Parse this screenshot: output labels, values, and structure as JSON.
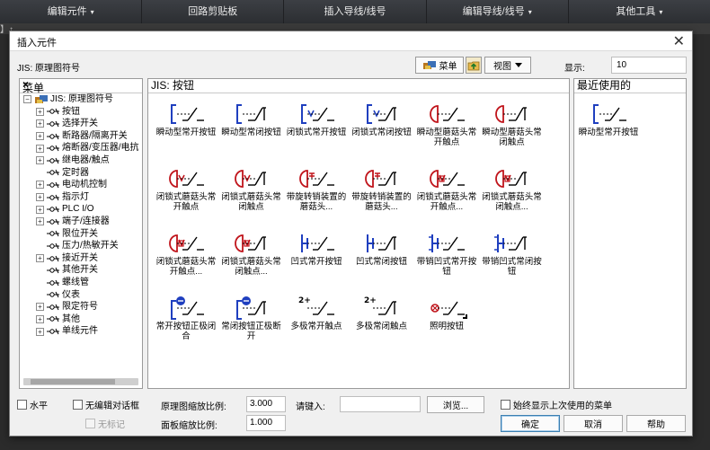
{
  "topbar": {
    "items": [
      "编辑元件",
      "回路剪贴板",
      "插入导线/线号",
      "编辑导线/线号",
      "其他工具"
    ],
    "carets": [
      "▾",
      "",
      "",
      "▾",
      "▾"
    ]
  },
  "strip": {
    "label": "】↑"
  },
  "dialog": {
    "title": "插入元件",
    "close": "✕",
    "path": "JIS: 原理图符号",
    "menu_button": "菜单",
    "view_button": "视图",
    "display_label": "显示:",
    "display_value": "10"
  },
  "tree": {
    "header": "菜单",
    "root": "JIS: 原理图符号",
    "items": [
      {
        "label": "按钮",
        "exp": true
      },
      {
        "label": "选择开关",
        "exp": true
      },
      {
        "label": "断路器/隔离开关",
        "exp": true
      },
      {
        "label": "熔断器/变压器/电抗",
        "exp": true
      },
      {
        "label": "继电器/触点",
        "exp": true
      },
      {
        "label": "定时器",
        "exp": false
      },
      {
        "label": "电动机控制",
        "exp": true
      },
      {
        "label": "指示灯",
        "exp": true
      },
      {
        "label": "PLC I/O",
        "exp": true
      },
      {
        "label": "端子/连接器",
        "exp": true
      },
      {
        "label": "限位开关",
        "exp": false
      },
      {
        "label": "压力/热敏开关",
        "exp": false
      },
      {
        "label": "接近开关",
        "exp": true
      },
      {
        "label": "其他开关",
        "exp": false
      },
      {
        "label": "螺线管",
        "exp": false
      },
      {
        "label": "仪表",
        "exp": false
      },
      {
        "label": "限定符号",
        "exp": true
      },
      {
        "label": "其他",
        "exp": true
      },
      {
        "label": "单线元件",
        "exp": true
      }
    ]
  },
  "grid": {
    "header": "JIS: 按钮",
    "items": [
      {
        "label": "瞬动型常开按钮",
        "icon": "pb-no",
        "color": "#1f3fbf"
      },
      {
        "label": "瞬动型常闭按钮",
        "icon": "pb-nc",
        "color": "#1f3fbf"
      },
      {
        "label": "闭锁式常开按钮",
        "icon": "pb-latch-no",
        "color": "#1f3fbf"
      },
      {
        "label": "闭锁式常闭按钮",
        "icon": "pb-latch-nc",
        "color": "#1f3fbf"
      },
      {
        "label": "瞬动型蘑菇头常开触点",
        "icon": "mush-no",
        "color": "#c0141b"
      },
      {
        "label": "瞬动型蘑菇头常闭触点",
        "icon": "mush-nc",
        "color": "#c0141b"
      },
      {
        "label": "闭锁式蘑菇头常开触点",
        "icon": "mush-latch-no",
        "color": "#c0141b"
      },
      {
        "label": "闭锁式蘑菇头常闭触点",
        "icon": "mush-latch-nc",
        "color": "#c0141b"
      },
      {
        "label": "带旋转销装置的蘑菇头...",
        "icon": "mush-twist-no",
        "color": "#c0141b"
      },
      {
        "label": "带旋转销装置的蘑菇头...",
        "icon": "mush-twist-nc",
        "color": "#c0141b"
      },
      {
        "label": "闭锁式蘑菇头常开触点...",
        "icon": "mush-latch-no2",
        "color": "#c0141b"
      },
      {
        "label": "闭锁式蘑菇头常闭触点...",
        "icon": "mush-latch-nc2",
        "color": "#c0141b"
      },
      {
        "label": "闭锁式蘑菇头常开触点...",
        "icon": "mush-latch-no3",
        "color": "#c0141b"
      },
      {
        "label": "闭锁式蘑菇头常闭触点...",
        "icon": "mush-latch-nc3",
        "color": "#c0141b"
      },
      {
        "label": "凹式常开按钮",
        "icon": "recess-no",
        "color": "#1f3fbf"
      },
      {
        "label": "凹式常闭按钮",
        "icon": "recess-nc",
        "color": "#1f3fbf"
      },
      {
        "label": "带销凹式常开按钮",
        "icon": "pin-recess-no",
        "color": "#1f3fbf"
      },
      {
        "label": "带销凹式常闭按钮",
        "icon": "pin-recess-nc",
        "color": "#1f3fbf"
      },
      {
        "label": "常开按钮正极闭合",
        "icon": "pos-no",
        "color": "#1f3fbf"
      },
      {
        "label": "常闭按钮正极断开",
        "icon": "pos-nc",
        "color": "#1f3fbf"
      },
      {
        "label": "多极常开触点",
        "icon": "multi-no",
        "color": "#000000"
      },
      {
        "label": "多极常闭触点",
        "icon": "multi-nc",
        "color": "#000000"
      },
      {
        "label": "照明按钮",
        "icon": "lit",
        "color": "#c0141b"
      }
    ]
  },
  "recent": {
    "header": "最近使用的",
    "items": [
      {
        "label": "瞬动型常开按钮",
        "icon": "pb-no",
        "color": "#1f3fbf"
      }
    ]
  },
  "bottom": {
    "horizontal": "水平",
    "no_edit_dialog": "无编辑对话框",
    "no_tag": "无标记",
    "schematic_scale_label": "原理图缩放比例:",
    "schematic_scale_value": "3.000",
    "panel_scale_label": "面板缩放比例:",
    "panel_scale_value": "1.000",
    "type_in_label": "请键入:",
    "type_in_value": "",
    "browse": "浏览...",
    "always_show_last_menu": "始终显示上次使用的菜单",
    "ok": "确定",
    "cancel": "取消",
    "help": "帮助"
  }
}
